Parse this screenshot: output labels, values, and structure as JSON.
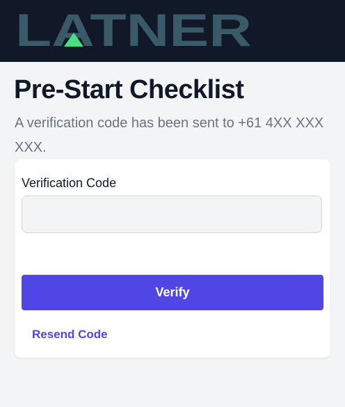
{
  "header": {
    "logo_text": "LATNER",
    "colors": {
      "background": "#111827",
      "logo": "#3a5a68",
      "logo_accent": "#4ade80"
    }
  },
  "main": {
    "title": "Pre-Start Checklist",
    "subtitle": "A verification code has been sent to +61 4XX XXX XXX."
  },
  "form": {
    "code_label": "Verification Code",
    "code_value": "",
    "code_placeholder": "",
    "verify_label": "Verify",
    "resend_label": "Resend Code"
  },
  "colors": {
    "accent": "#4f46e5",
    "page_background": "#f3f4f6",
    "card_background": "#ffffff"
  }
}
